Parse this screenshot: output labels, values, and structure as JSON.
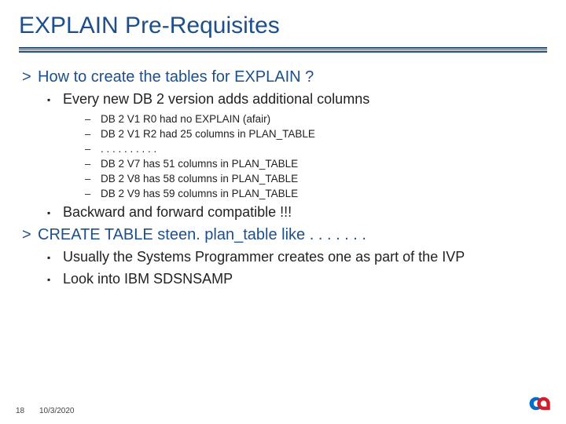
{
  "title": "EXPLAIN Pre-Requisites",
  "body": [
    {
      "level": 1,
      "text": "How to create the tables for EXPLAIN ?"
    },
    {
      "level": 2,
      "text": "Every new DB 2 version adds additional columns"
    },
    {
      "level": 3,
      "text": "DB 2 V1 R0 had no EXPLAIN (afair)"
    },
    {
      "level": 3,
      "text": "DB 2 V1 R2 had 25 columns in PLAN_TABLE"
    },
    {
      "level": 3,
      "text": ". . . . . . . . . ."
    },
    {
      "level": 3,
      "text": "DB 2 V7 has 51 columns in PLAN_TABLE"
    },
    {
      "level": 3,
      "text": "DB 2 V8 has 58 columns in PLAN_TABLE"
    },
    {
      "level": 3,
      "text": "DB 2 V9 has 59 columns in PLAN_TABLE"
    },
    {
      "level": 2,
      "text": "Backward and forward compatible !!!"
    },
    {
      "level": 1,
      "text": "CREATE TABLE steen. plan_table like  . . . . . . ."
    },
    {
      "level": 2,
      "text": "Usually the Systems Programmer creates one as part of the IVP"
    },
    {
      "level": 2,
      "text": "Look into IBM SDSNSAMP"
    }
  ],
  "markers": {
    "lvl1": ">",
    "lvl2": "▪",
    "lvl3": "–"
  },
  "footer": {
    "page": "18",
    "date": "10/3/2020"
  },
  "brand_colors": {
    "primary": "#1d4f8b",
    "logo_blue": "#0a6cc1",
    "logo_red": "#d1202b"
  }
}
